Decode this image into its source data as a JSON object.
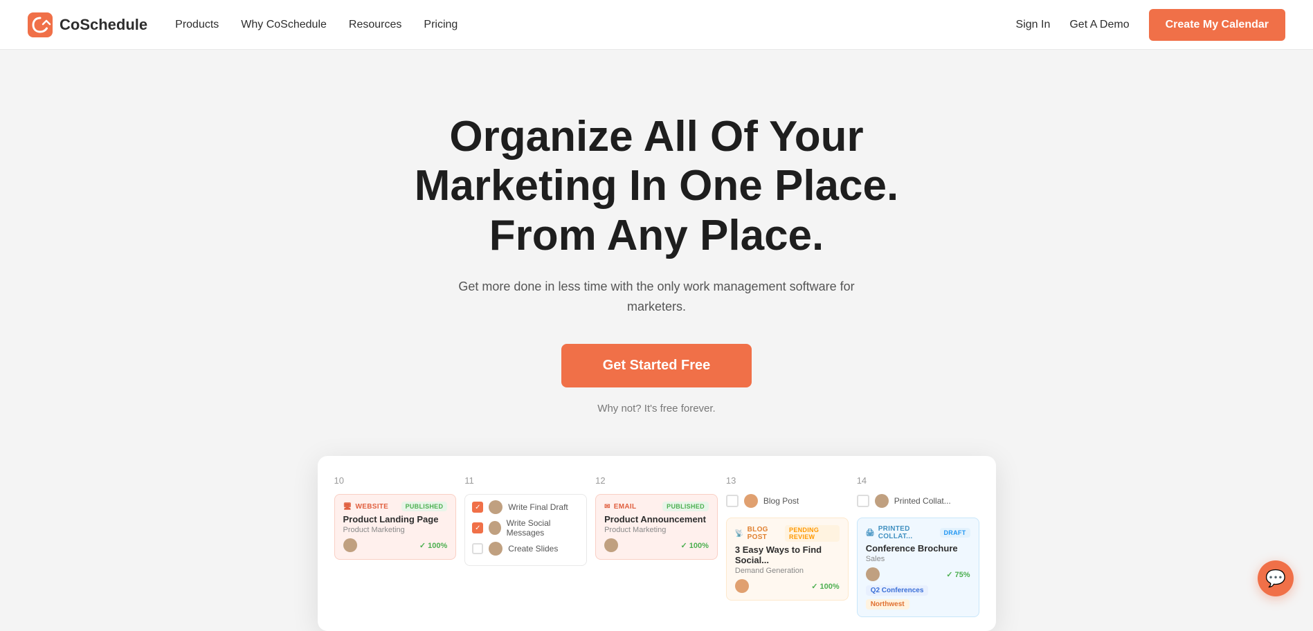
{
  "brand": {
    "name": "CoSchedule",
    "logo_alt": "CoSchedule logo"
  },
  "nav": {
    "links": [
      {
        "id": "products",
        "label": "Products"
      },
      {
        "id": "why",
        "label": "Why CoSchedule"
      },
      {
        "id": "resources",
        "label": "Resources"
      },
      {
        "id": "pricing",
        "label": "Pricing"
      }
    ],
    "sign_in": "Sign In",
    "get_demo": "Get A Demo",
    "create_calendar": "Create My Calendar"
  },
  "hero": {
    "title": "Organize All Of Your Marketing In One Place. From Any Place.",
    "subtitle": "Get more done in less time with the only work management software for marketers.",
    "cta_button": "Get Started Free",
    "cta_note": "Why not? It's free forever."
  },
  "calendar": {
    "days": [
      {
        "num": "10",
        "label": "day-10"
      },
      {
        "num": "11",
        "label": "day-11"
      },
      {
        "num": "12",
        "label": "day-12"
      },
      {
        "num": "13",
        "label": "day-13"
      },
      {
        "num": "14",
        "label": "day-14"
      }
    ],
    "cards": {
      "day10": {
        "type": "website",
        "tag": "Website",
        "badge": "Published",
        "title": "Product Landing Page",
        "sub": "Product Marketing",
        "avatar": "Whitney",
        "progress": "100%"
      },
      "day11": {
        "checklist": [
          {
            "text": "Write Final Draft",
            "checked": true,
            "avatar": true
          },
          {
            "text": "Write Social Messages",
            "checked": true,
            "avatar": true
          },
          {
            "text": "Create Slides",
            "checked": false,
            "avatar": true
          }
        ]
      },
      "day12": {
        "type": "email",
        "tag": "Email",
        "badge": "Published",
        "title": "Product Announcement",
        "sub": "Product Marketing",
        "avatar": "Whitney",
        "progress": "100%"
      },
      "day13": {
        "type": "blog",
        "tag": "Blog Post",
        "badge": "Pending Review",
        "title": "3 Easy Ways to Find Social...",
        "sub": "Demand Generation",
        "avatar": "Leah",
        "progress": "100%"
      },
      "day14": {
        "type": "print",
        "tag": "Printed Collat...",
        "badge": "Draft",
        "title": "Conference Brochure",
        "sub": "Sales",
        "avatar": "Whitney",
        "progress": "75%",
        "tags": [
          "Q2 Conferences",
          "Northwest"
        ]
      }
    }
  },
  "chat": {
    "icon": "💬"
  }
}
